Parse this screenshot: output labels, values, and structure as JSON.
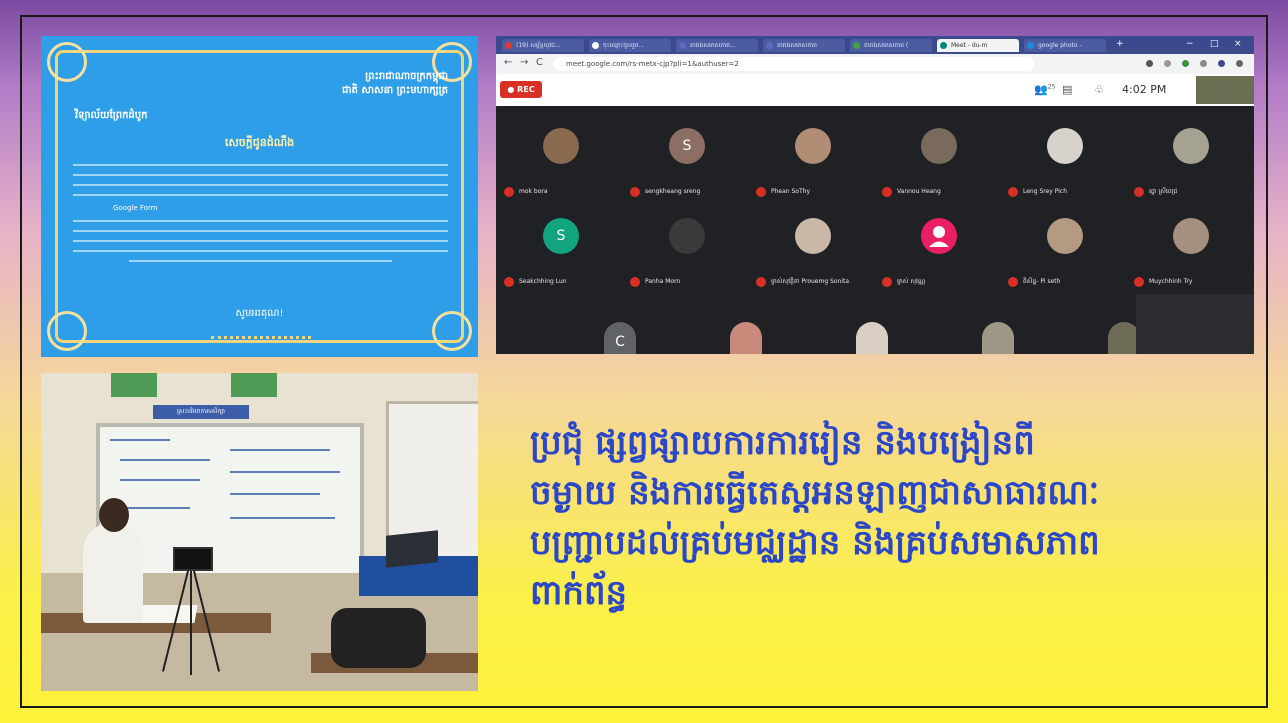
{
  "slide": {
    "headline_lines": [
      "ប្រជុំ ផ្សព្វផ្សាយការការរៀន និងបង្រៀនពី",
      "ចម្ងាយ និងការធ្វើតេស្តអនឡាញជាសាធារណៈ",
      "បញ្ជ្រាបដល់គ្រប់មជ្ឈដ្ឋាន និងគ្រប់សមាសភាព",
      "ពាក់ព័ន្ធ"
    ],
    "colors": {
      "headline": "#2b47c8",
      "border": "#1a1a1a"
    }
  },
  "certificate": {
    "motto_line1": "ព្រះរាជាណាចក្រកម្ពុជា",
    "motto_line2": "ជាតិ សាសនា ព្រះមហាក្សត្រ",
    "office": "វិទ្យាល័យព្រែកដំបូក",
    "heading": "សេចក្តីជូនដំណឹង",
    "google_form": "Google Form",
    "closing": "សូមអរគុណ!"
  },
  "meet": {
    "tabs": [
      {
        "label": "(19) សម្ព័ន្ធយុវជ...",
        "color": "#e53935"
      },
      {
        "label": "ចុះឈ្មោះចូលរួម...",
        "color": "#ffffff"
      },
      {
        "label": "តារាងសមាសភាព...",
        "color": "#5c6bc0"
      },
      {
        "label": "តារាងសមាសភាព",
        "color": "#5c6bc0"
      },
      {
        "label": "តារាងសមាសភាព (",
        "color": "#43a047"
      },
      {
        "label": "Meet - du-m",
        "color": "#00897b"
      },
      {
        "label": "google photo -",
        "color": "#1e88e5"
      }
    ],
    "url": "meet.google.com/rs-metx-cjp?pli=1&authuser=2",
    "rec_label": "REC",
    "time": "4:02 PM",
    "participant_count": "25",
    "participants": [
      {
        "name": "mok bora",
        "avatar": "photo",
        "color": "#8a6a4f"
      },
      {
        "name": "sengkheang sreng",
        "avatar": "S",
        "color": "#8d6e63"
      },
      {
        "name": "Phean SoThy",
        "avatar": "photo",
        "color": "#b08d74"
      },
      {
        "name": "Vannou Heang",
        "avatar": "photo",
        "color": "#7a6a5c"
      },
      {
        "name": "Leng Srey Pich",
        "avatar": "photo",
        "color": "#d8d2cc"
      },
      {
        "name": "រដ្ឋា ស្រីពេជ្រ",
        "avatar": "photo",
        "color": "#a6a291"
      },
      {
        "name": "Seakchhing Lun",
        "avatar": "S",
        "color": "#12a37f"
      },
      {
        "name": "Panha Morn",
        "avatar": "photo",
        "color": "#3a3a3a"
      },
      {
        "name": "ម្ចាស់សុវត្ថិតា Prouemg Sonita",
        "avatar": "photo",
        "color": "#c9b8a8"
      },
      {
        "name": "ម្ចាស់ សុវណ្ណ",
        "avatar": "person",
        "color": "#e91e63"
      },
      {
        "name": "ពិសិដ្ឋ- Pi seth",
        "avatar": "photo",
        "color": "#b49a80"
      },
      {
        "name": "Muychhinh Try",
        "avatar": "photo",
        "color": "#a58f7e"
      }
    ],
    "bottom_row": [
      {
        "avatar": "C",
        "color": "#5f6368"
      },
      {
        "avatar": "photo",
        "color": "#c98a7c"
      },
      {
        "avatar": "photo",
        "color": "#d9cfc3"
      },
      {
        "avatar": "photo",
        "color": "#9e9786"
      },
      {
        "avatar": "photo",
        "color": "#6d6b55"
      }
    ]
  },
  "classroom": {
    "banner": "ស្រះបរិយាកាសសិក្សា"
  }
}
